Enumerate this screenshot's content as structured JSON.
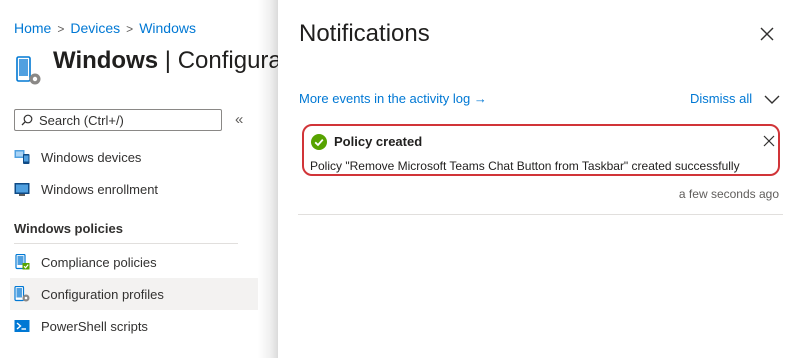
{
  "breadcrumb": {
    "items": [
      "Home",
      "Devices",
      "Windows"
    ]
  },
  "page": {
    "title_bold": "Windows",
    "title_sep": " | ",
    "title_rest": "Configurat"
  },
  "search": {
    "placeholder": "Search (Ctrl+/)"
  },
  "collapse_glyph": "«",
  "nav": {
    "items_top": [
      {
        "label": "Windows devices",
        "icon": "windows-devices-icon"
      },
      {
        "label": "Windows enrollment",
        "icon": "windows-enrollment-icon"
      }
    ],
    "section_header": "Windows policies",
    "items_policies": [
      {
        "label": "Compliance policies",
        "icon": "compliance-policies-icon"
      },
      {
        "label": "Configuration profiles",
        "icon": "configuration-profiles-icon",
        "selected": true
      },
      {
        "label": "PowerShell scripts",
        "icon": "powershell-scripts-icon"
      }
    ]
  },
  "notifications": {
    "title": "Notifications",
    "activity_link": "More events in the activity log",
    "activity_arrow": "→",
    "dismiss_all": "Dismiss all",
    "items": [
      {
        "status": "success",
        "title": "Policy created",
        "message": "Policy \"Remove Microsoft Teams Chat Button from Taskbar\" created successfully",
        "time": "a few seconds ago"
      }
    ]
  },
  "colors": {
    "accent": "#0078d4",
    "success": "#57a300",
    "highlight_border": "#d13438",
    "selected_bg": "#f3f2f1"
  }
}
